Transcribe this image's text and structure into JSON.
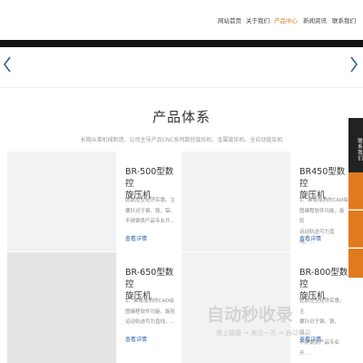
{
  "nav": {
    "items": [
      "网站首页",
      "关于我们",
      "产品中心",
      "新闻资讯",
      "联系我们"
    ],
    "active_index": 2
  },
  "colors": {
    "accent": "#e07a1f",
    "link": "#2e62a8",
    "band": "#111111"
  },
  "banner": {
    "prev_icon": "chevron-left-icon",
    "next_icon": "chevron-right-icon"
  },
  "section": {
    "title": "产品体系",
    "subtitle": "长期从事机械制造、公司主导产品CNC系列数控旋压机、金属旋压机、全自动旋压机"
  },
  "products": [
    {
      "title_line1": "BR-500型数控",
      "title_line2": "旋压机",
      "desc": [
        "此数控型经济实惠。主",
        "要针对于钢、铁、铝、",
        "不锈钢类产品专业开..."
      ],
      "more": "查看详情"
    },
    {
      "title_line1": "BR450型数控",
      "title_line2": "旋压机",
      "desc": [
        "1、具有成熟的CAD绘",
        "图编程软件功能，旋轮",
        "运动轨迹可为直线、..."
      ],
      "more": "查看详情"
    },
    {
      "title_line1": "BR-650型数控",
      "title_line2": "旋压机",
      "desc": [
        "1、具有成熟的CAD绘",
        "图编程软件功能，旋轮",
        "运动轨迹可为直线、..."
      ],
      "more": "查看详情"
    },
    {
      "title_line1": "BR-800型数控",
      "title_line2": "旋压机",
      "desc": [
        "此数控型经济实惠。主",
        "要针对于钢、铁、铝、",
        "不锈钢类产品专业开..."
      ],
      "more": "查看详情"
    }
  ],
  "side": {
    "contact_label": "联系我们"
  },
  "watermark": {
    "main": "自动秒收录",
    "sub": "做上链接 → 来访一次 → 自动收录"
  }
}
